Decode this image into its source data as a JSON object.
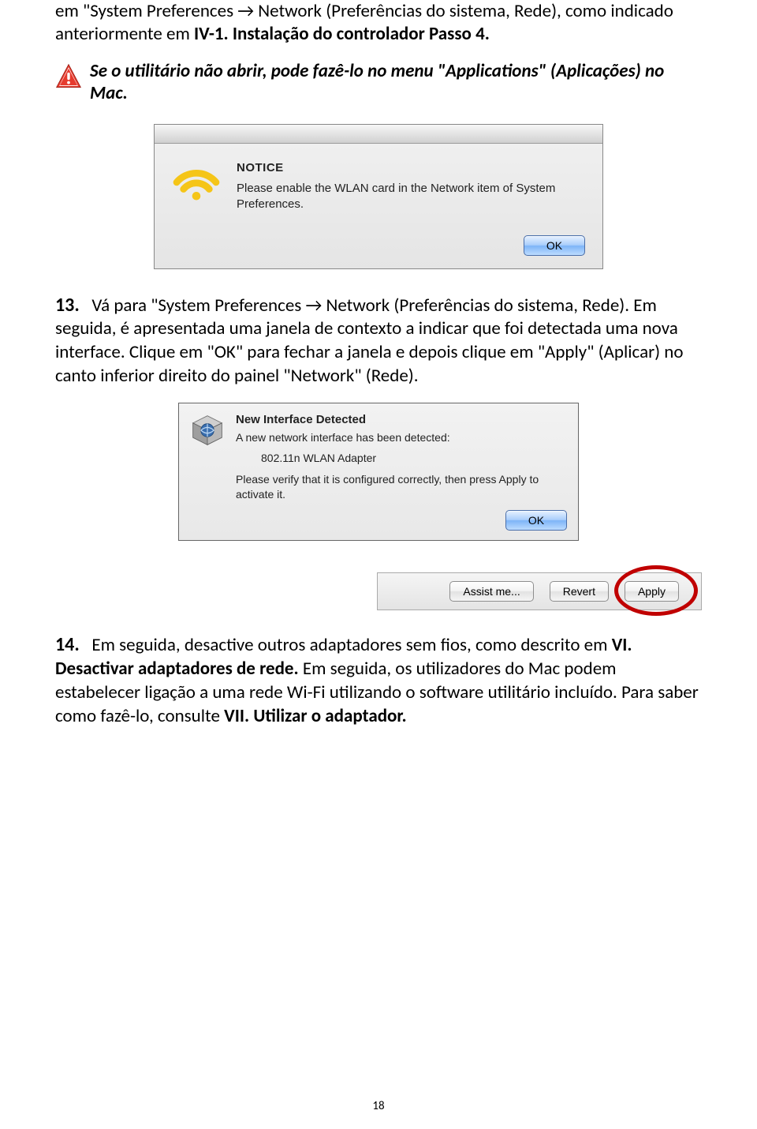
{
  "intro": {
    "text_a": "em \"System Preferences ",
    "text_b": " Network (Preferências do sistema, Rede), como indicado anteriormente em ",
    "ref1": "IV-1. Instalação do controlador Passo 4."
  },
  "note": "Se o utilitário não abrir, pode fazê-lo no menu \"Applications\" (Aplicações) no Mac.",
  "dialog1": {
    "title": "NOTICE",
    "message": "Please enable the WLAN card in the Network item of System Preferences.",
    "ok": "OK"
  },
  "step13": {
    "num": "13.",
    "body": "Vá para \"System Preferences → Network (Preferências do sistema, Rede). Em seguida, é apresentada uma janela de contexto a indicar que foi detectada uma nova interface. Clique em \"OK\" para fechar a janela e depois clique em \"Apply\" (Aplicar) no canto inferior direito do painel \"Network\" (Rede)."
  },
  "dialog2": {
    "title": "New Interface Detected",
    "line1": "A new network interface has been detected:",
    "adapter": "802.11n WLAN Adapter",
    "verify": "Please verify that it is configured correctly, then press Apply to activate it.",
    "ok": "OK"
  },
  "footerbar": {
    "assist": "Assist me...",
    "revert": "Revert",
    "apply": "Apply"
  },
  "step14": {
    "num": "14.",
    "body_a": "Em seguida, desactive outros adaptadores sem fios, como descrito em ",
    "ref2": "VI. Desactivar adaptadores de rede.",
    "body_b": " Em seguida, os utilizadores do Mac podem estabelecer ligação a uma rede Wi-Fi utilizando o software utilitário incluído. Para saber como fazê-lo, consulte ",
    "ref3": "VII. Utilizar o adaptador."
  },
  "page_number": "18"
}
